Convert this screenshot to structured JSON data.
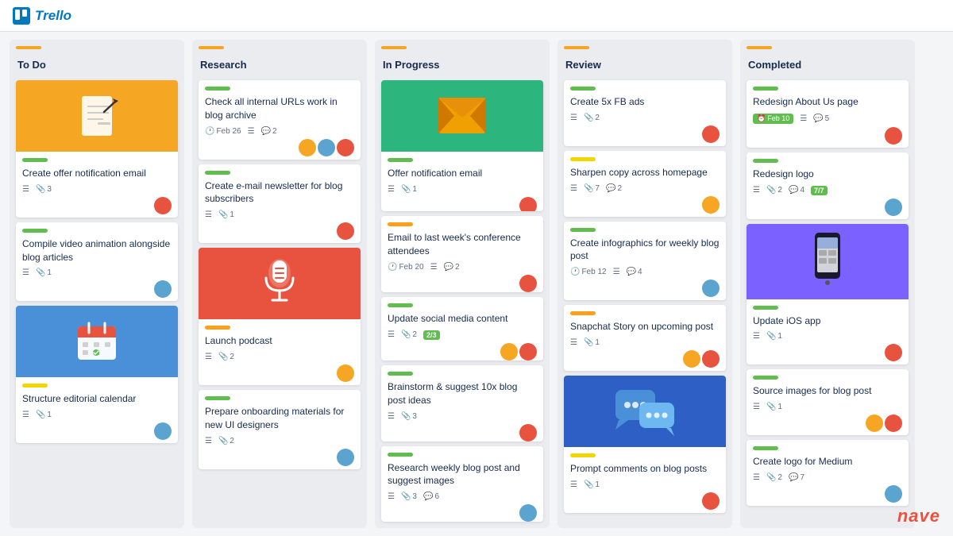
{
  "app": {
    "name": "Trello"
  },
  "columns": [
    {
      "id": "todo",
      "title": "To Do",
      "label_color": "yellow",
      "cards": [
        {
          "id": "c1",
          "has_image": "yellow-note",
          "label": "green",
          "title": "Create offer notification email",
          "meta_lines": 1,
          "meta_attachments": 3,
          "avatars": [
            "#e8533f"
          ]
        },
        {
          "id": "c2",
          "has_image": null,
          "label": "green",
          "title": "Compile video animation alongside blog articles",
          "meta_lines": 1,
          "meta_attachments": 1,
          "avatars": [
            "#5ba4cf"
          ]
        },
        {
          "id": "c3",
          "has_image": "blue-calendar",
          "label": "yellow",
          "title": "Structure editorial calendar",
          "meta_lines": 1,
          "meta_attachments": 1,
          "avatars": [
            "#5ba4cf"
          ]
        }
      ]
    },
    {
      "id": "research",
      "title": "Research",
      "label_color": "yellow",
      "cards": [
        {
          "id": "r1",
          "has_image": null,
          "label": "green",
          "title": "Check all internal URLs work in blog archive",
          "date": "Feb 26",
          "meta_lines": 1,
          "meta_comments": 2,
          "meta_attachments": null,
          "avatars": [
            "#f6a623",
            "#5ba4cf",
            "#e8533f"
          ]
        },
        {
          "id": "r2",
          "has_image": null,
          "label": "green",
          "title": "Create e-mail newsletter for blog subscribers",
          "meta_lines": 1,
          "meta_attachments": 1,
          "avatars": [
            "#e8533f"
          ]
        },
        {
          "id": "r3",
          "has_image": "orange-mic",
          "label": "orange",
          "title": "Launch podcast",
          "meta_lines": 1,
          "meta_attachments": 2,
          "avatars": [
            "#f6a623"
          ]
        },
        {
          "id": "r4",
          "has_image": null,
          "label": "green",
          "title": "Prepare onboarding materials for new UI designers",
          "meta_lines": 1,
          "meta_attachments": 2,
          "avatars": [
            "#5ba4cf"
          ]
        }
      ]
    },
    {
      "id": "inprogress",
      "title": "In Progress",
      "label_color": "yellow",
      "cards": [
        {
          "id": "ip1",
          "has_image": "green-email",
          "label": "green",
          "title": "Offer notification email",
          "meta_lines": 1,
          "meta_attachments": 1,
          "avatars": [
            "#e8533f"
          ]
        },
        {
          "id": "ip2",
          "has_image": null,
          "label": "orange",
          "title": "Email to last week's conference attendees",
          "date": "Feb 20",
          "meta_lines": 1,
          "meta_comments": 2,
          "avatars": [
            "#e8533f"
          ]
        },
        {
          "id": "ip3",
          "has_image": null,
          "label": "green",
          "title": "Update social media content",
          "meta_lines": 1,
          "meta_attachments": 2,
          "badge": "2/3",
          "avatars": [
            "#f6a623",
            "#e8533f"
          ]
        },
        {
          "id": "ip4",
          "has_image": null,
          "label": "green",
          "title": "Brainstorm & suggest 10x blog post ideas",
          "meta_lines": 1,
          "meta_attachments": 3,
          "avatars": [
            "#e8533f"
          ]
        },
        {
          "id": "ip5",
          "has_image": null,
          "label": "green",
          "title": "Research weekly blog post and suggest images",
          "meta_lines": 1,
          "meta_attachments": 3,
          "meta_comments": 6,
          "avatars": [
            "#5ba4cf"
          ]
        }
      ]
    },
    {
      "id": "review",
      "title": "Review",
      "label_color": "yellow",
      "cards": [
        {
          "id": "rv1",
          "has_image": null,
          "label": "green",
          "title": "Create 5x FB ads",
          "meta_lines": 1,
          "meta_attachments": 2,
          "avatars": [
            "#e8533f"
          ]
        },
        {
          "id": "rv2",
          "has_image": null,
          "label": "yellow",
          "title": "Sharpen copy across homepage",
          "meta_lines": 1,
          "meta_attachments": 7,
          "meta_comments": 2,
          "avatars": [
            "#f6a623"
          ]
        },
        {
          "id": "rv3",
          "has_image": null,
          "label": "green",
          "title": "Create infographics for weekly blog post",
          "date": "Feb 12",
          "meta_lines": 1,
          "meta_comments": 4,
          "avatars": [
            "#5ba4cf"
          ]
        },
        {
          "id": "rv4",
          "has_image": null,
          "label": "orange",
          "title": "Snapchat Story on upcoming post",
          "meta_lines": 1,
          "meta_attachments": 1,
          "avatars": [
            "#f6a623",
            "#e8533f"
          ]
        },
        {
          "id": "rv5",
          "has_image": "blue-chat",
          "label": "yellow",
          "title": "Prompt comments on blog posts",
          "meta_lines": 1,
          "meta_attachments": 1,
          "avatars": [
            "#e8533f"
          ]
        }
      ]
    },
    {
      "id": "completed",
      "title": "Completed",
      "label_color": "yellow",
      "cards": [
        {
          "id": "cp1",
          "has_image": null,
          "label": "green",
          "title": "Redesign About Us page",
          "date_badge": "Feb 10",
          "meta_lines": 1,
          "meta_comments": 5,
          "avatars": [
            "#e8533f"
          ]
        },
        {
          "id": "cp2",
          "has_image": null,
          "label": "green",
          "title": "Redesign logo",
          "meta_lines": 1,
          "meta_comments": 4,
          "meta_attachments": 2,
          "badge": "7/7",
          "avatars": [
            "#5ba4cf"
          ]
        },
        {
          "id": "cp3",
          "has_image": "purple-phone",
          "label": "green",
          "title": "Update iOS app",
          "meta_lines": 1,
          "meta_attachments": 1,
          "avatars": [
            "#e8533f"
          ]
        },
        {
          "id": "cp4",
          "has_image": null,
          "label": "green",
          "title": "Source images for blog post",
          "meta_lines": 1,
          "meta_attachments": 1,
          "avatars": [
            "#f6a623",
            "#e8533f"
          ]
        },
        {
          "id": "cp5",
          "has_image": null,
          "label": "green",
          "title": "Create logo for Medium",
          "meta_lines": 1,
          "meta_comments": 7,
          "meta_attachments": 2,
          "avatars": [
            "#5ba4cf"
          ]
        }
      ]
    }
  ],
  "nave": "nave"
}
